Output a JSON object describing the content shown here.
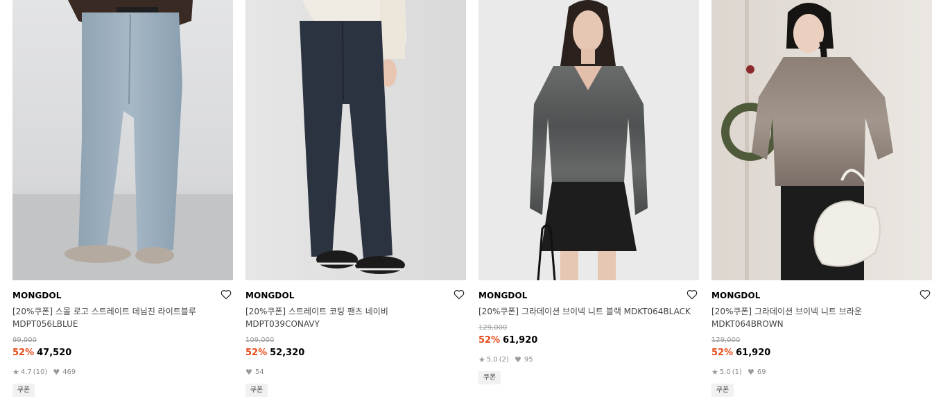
{
  "products": [
    {
      "brand": "MONGDOL",
      "title": "[20%쿠폰] 스몰 로고 스트레이트 데님진 라이트블루\nMDPT056LBLUE",
      "original_price": "99,000",
      "discount": "52%",
      "price": "47,520",
      "rating": "4.7",
      "review_count": "(10)",
      "likes": "469",
      "badge": "쿠폰"
    },
    {
      "brand": "MONGDOL",
      "title": "[20%쿠폰] 스트레이트 코팅 팬츠 네이비\nMDPT039CONAVY",
      "original_price": "109,000",
      "discount": "52%",
      "price": "52,320",
      "rating": "",
      "review_count": "",
      "likes": "54",
      "badge": "쿠폰"
    },
    {
      "brand": "MONGDOL",
      "title": "[20%쿠폰] 그라데이션 브이넥 니트 블랙 MDKT064BLACK",
      "original_price": "129,000",
      "discount": "52%",
      "price": "61,920",
      "rating": "5.0",
      "review_count": "(2)",
      "likes": "95",
      "badge": "쿠폰"
    },
    {
      "brand": "MONGDOL",
      "title": "[20%쿠폰] 그라데이션 브이넥 니트 브라운\nMDKT064BROWN",
      "original_price": "129,000",
      "discount": "52%",
      "price": "61,920",
      "rating": "5.0",
      "review_count": "(1)",
      "likes": "69",
      "badge": "쿠폰"
    }
  ],
  "colors": {
    "discount": "#e64a19",
    "muted": "#888888",
    "badge_bg": "#f1f1f1"
  }
}
